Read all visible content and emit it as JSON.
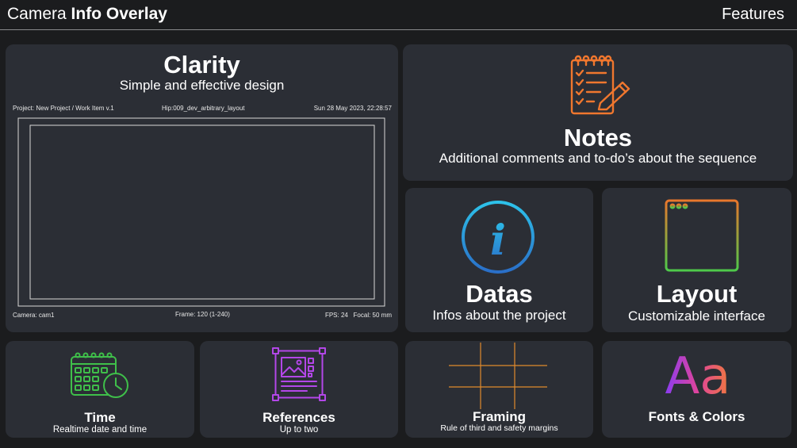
{
  "header": {
    "title_regular": "Camera",
    "title_bold": "Info Overlay",
    "section": "Features"
  },
  "clarity": {
    "title": "Clarity",
    "subtitle": "Simple and effective design",
    "overlay": {
      "project": "Project: New Project / Work Item v.1",
      "file": "Hip:009_dev_arbitrary_layout",
      "datetime": "Sun 28 May 2023, 22:28:57",
      "camera": "Camera: cam1",
      "frame": "Frame: 120 (1-240)",
      "fps": "FPS: 24",
      "focal": "Focal: 50 mm"
    }
  },
  "notes": {
    "title": "Notes",
    "subtitle": "Additional comments and to-do’s about the sequence"
  },
  "datas": {
    "title": "Datas",
    "subtitle": "Infos about the project",
    "icon_glyph": "i"
  },
  "layout": {
    "title": "Layout",
    "subtitle": "Customizable interface"
  },
  "time": {
    "title": "Time",
    "subtitle": "Realtime date and time"
  },
  "references": {
    "title": "References",
    "subtitle": "Up to two"
  },
  "framing": {
    "title": "Framing",
    "subtitle": "Rule of third and safety margins"
  },
  "fonts": {
    "title": "Fonts & Colors",
    "icon_text": "Aa"
  },
  "colors": {
    "background": "#1b1c1e",
    "card": "#2b2e35",
    "notes_icon": "#f0772e",
    "datas_icon_start": "#2dc2ea",
    "datas_icon_end": "#2a6fc8",
    "time_icon": "#3fbf4a",
    "references_icon": "#b347e8",
    "framing_lines": "#e08a2c"
  }
}
